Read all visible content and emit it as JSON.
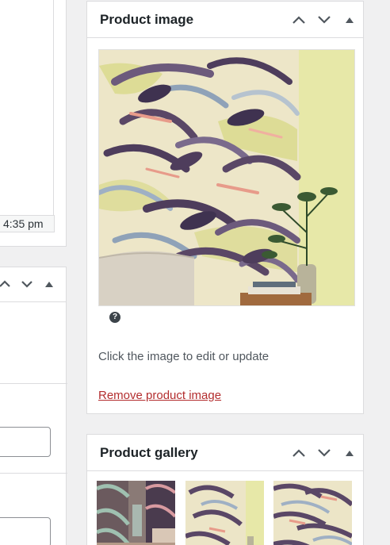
{
  "left_panel": {
    "time_text": "4:35 pm"
  },
  "product_image": {
    "title": "Product image",
    "help_glyph": "?",
    "hint": "Click the image to edit or update",
    "remove_link": "Remove product image",
    "image_icon": "swallow-wallpaper-image"
  },
  "product_gallery": {
    "title": "Product gallery",
    "thumbnails": [
      "gallery-thumb-1",
      "gallery-thumb-2",
      "gallery-thumb-3"
    ]
  },
  "colors": {
    "link_remove": "#b32d2e",
    "border": "#dcdcde",
    "background": "#f0f0f1",
    "wall_yellow": "#e8e9a6"
  }
}
